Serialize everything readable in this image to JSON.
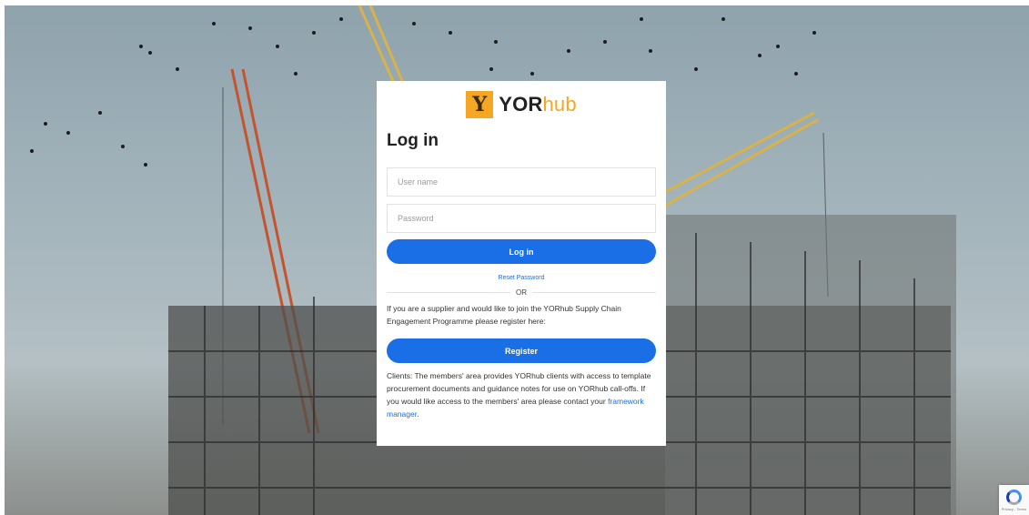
{
  "logo": {
    "mark": "Y",
    "text_bold": "YOR",
    "text_light": "hub"
  },
  "form": {
    "title": "Log in",
    "username_placeholder": "User name",
    "password_placeholder": "Password",
    "login_label": "Log in",
    "reset_label": "Reset Password",
    "or_label": "OR",
    "supplier_text": "If you are a supplier and would like to join the YORhub Supply Chain Engagement Programme please register here:",
    "register_label": "Register",
    "clients_text": "Clients: The members' area provides YORhub clients with access to template procurement documents and guidance notes for use on YORhub call-offs. If you would like access to the members' area please contact your ",
    "framework_link": "framework manager",
    "clients_end": "."
  },
  "recaptcha": {
    "text": "Privacy - Terms"
  },
  "colors": {
    "accent": "#1a6fe6",
    "brand": "#f5a623"
  },
  "icons": {
    "recaptcha": "recaptcha-icon"
  }
}
